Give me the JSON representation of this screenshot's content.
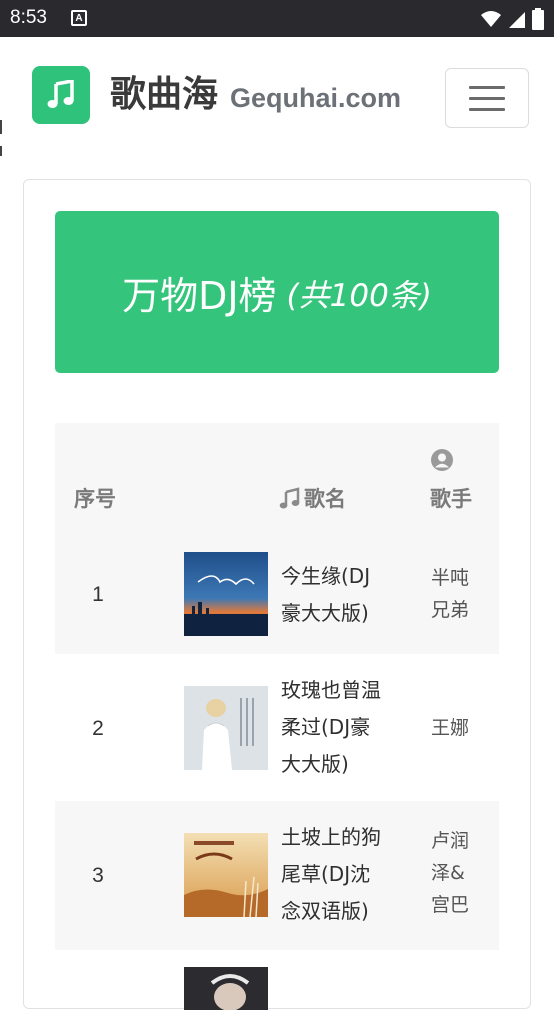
{
  "status_bar": {
    "time": "8:53",
    "notification_icon": "a-box-icon",
    "icons": [
      "wifi-icon",
      "signal-icon",
      "battery-icon"
    ]
  },
  "header": {
    "logo_icon": "music-note-icon",
    "brand_cn": "歌曲海",
    "brand_en": "Gequhai.com",
    "menu_icon": "hamburger-menu-icon"
  },
  "banner": {
    "title": "万物DJ榜",
    "count": "(共100条)"
  },
  "table": {
    "headers": {
      "index": "序号",
      "title": "歌名",
      "artist": "歌手"
    },
    "rows": [
      {
        "index": "1",
        "title_lines": [
          "今生缘(DJ",
          "豪大大版)"
        ],
        "artist_lines": [
          "半吨",
          "兄弟"
        ]
      },
      {
        "index": "2",
        "title_lines": [
          "玫瑰也曾温",
          "柔过(DJ豪",
          "大大版)"
        ],
        "artist_lines": [
          "王娜"
        ]
      },
      {
        "index": "3",
        "title_lines": [
          "土坡上的狗",
          "尾草(DJ沈",
          "念双语版)"
        ],
        "artist_lines": [
          "卢润",
          "泽&",
          "宫巴"
        ]
      }
    ]
  },
  "colors": {
    "accent_green": "#35c47c",
    "status_bar_bg": "#2a2a2e"
  }
}
